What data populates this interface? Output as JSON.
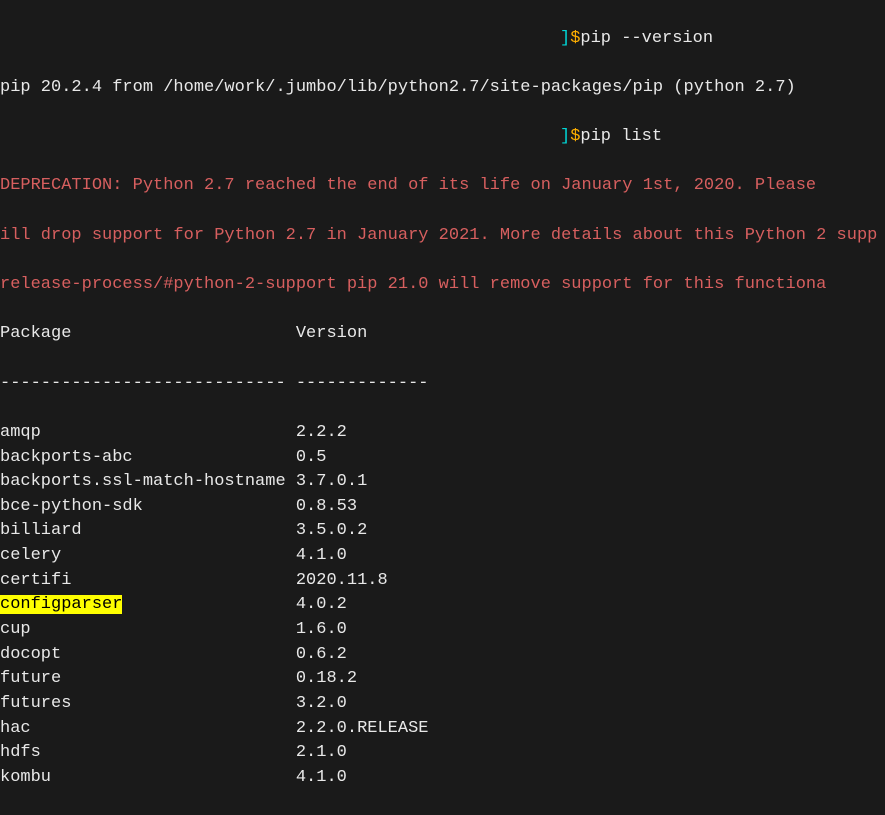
{
  "prompt_bracket": "]",
  "prompt_dollar": "$",
  "commands": {
    "pip_version": "pip --version",
    "pip_list": "pip list"
  },
  "pip_version_output": "pip 20.2.4 from /home/work/.jumbo/lib/python2.7/site-packages/pip (python 2.7)",
  "deprecation": {
    "line1": "DEPRECATION: Python 2.7 reached the end of its life on January 1st, 2020. Please ",
    "line2": "ill drop support for Python 2.7 in January 2021. More details about this Python 2 supp",
    "line3": "release-process/#python-2-support pip 21.0 will remove support for this functiona"
  },
  "table_header": {
    "package": "Package",
    "version": "Version"
  },
  "table_divider": "---------------------------- -------------",
  "packages": [
    {
      "name": "amqp",
      "version": "2.2.2",
      "highlighted": false
    },
    {
      "name": "backports-abc",
      "version": "0.5",
      "highlighted": false
    },
    {
      "name": "backports.ssl-match-hostname",
      "version": "3.7.0.1",
      "highlighted": false
    },
    {
      "name": "bce-python-sdk",
      "version": "0.8.53",
      "highlighted": false
    },
    {
      "name": "billiard",
      "version": "3.5.0.2",
      "highlighted": false
    },
    {
      "name": "celery",
      "version": "4.1.0",
      "highlighted": false
    },
    {
      "name": "certifi",
      "version": "2020.11.8",
      "highlighted": false
    },
    {
      "name": "configparser",
      "version": "4.0.2",
      "highlighted": true
    },
    {
      "name": "cup",
      "version": "1.6.0",
      "highlighted": false
    },
    {
      "name": "docopt",
      "version": "0.6.2",
      "highlighted": false
    },
    {
      "name": "future",
      "version": "0.18.2",
      "highlighted": false
    },
    {
      "name": "futures",
      "version": "3.2.0",
      "highlighted": false
    },
    {
      "name": "hac",
      "version": "2.2.0.RELEASE",
      "highlighted": false
    },
    {
      "name": "hdfs",
      "version": "2.1.0",
      "highlighted": false
    },
    {
      "name": "kombu",
      "version": "4.1.0",
      "highlighted": false
    }
  ]
}
